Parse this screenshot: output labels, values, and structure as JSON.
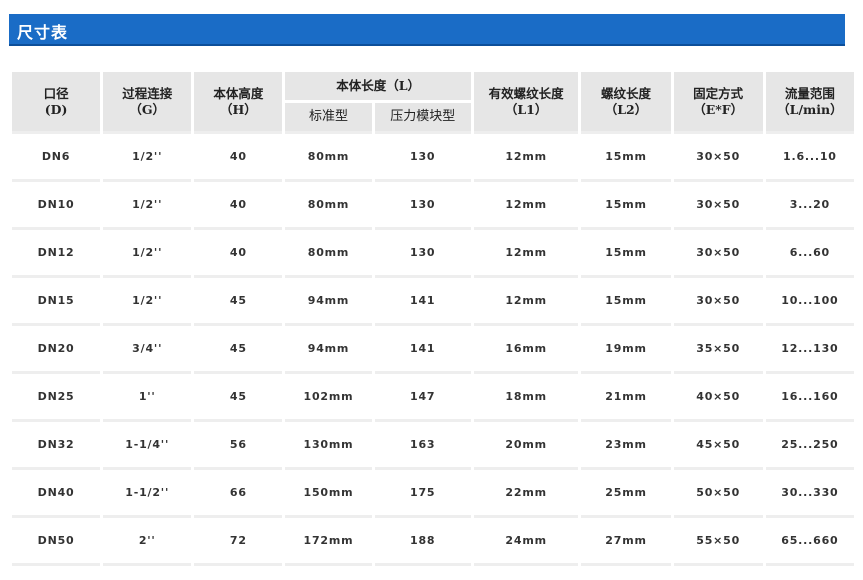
{
  "title": "尺寸表",
  "headers": {
    "diameter": [
      "口径",
      "(D)"
    ],
    "connection": [
      "过程连接",
      "（G）"
    ],
    "height": [
      "本体高度",
      "（H）"
    ],
    "length": "本体长度（L）",
    "length_standard": "标准型",
    "length_pressure": "压力模块型",
    "thread_effective": [
      "有效螺纹长度",
      "（L1）"
    ],
    "thread_length": [
      "螺纹长度",
      "（L2）"
    ],
    "fixing": [
      "固定方式",
      "（E*F）"
    ],
    "flow": [
      "流量范围",
      "（L/min）"
    ]
  },
  "rows": [
    [
      "DN6",
      "1/2''",
      "40",
      "80mm",
      "130",
      "12mm",
      "15mm",
      "30×50",
      "1.6...10"
    ],
    [
      "DN10",
      "1/2''",
      "40",
      "80mm",
      "130",
      "12mm",
      "15mm",
      "30×50",
      "3...20"
    ],
    [
      "DN12",
      "1/2''",
      "40",
      "80mm",
      "130",
      "12mm",
      "15mm",
      "30×50",
      "6...60"
    ],
    [
      "DN15",
      "1/2''",
      "45",
      "94mm",
      "141",
      "12mm",
      "15mm",
      "30×50",
      "10...100"
    ],
    [
      "DN20",
      "3/4''",
      "45",
      "94mm",
      "141",
      "16mm",
      "19mm",
      "35×50",
      "12...130"
    ],
    [
      "DN25",
      "1''",
      "45",
      "102mm",
      "147",
      "18mm",
      "21mm",
      "40×50",
      "16...160"
    ],
    [
      "DN32",
      "1-1/4''",
      "56",
      "130mm",
      "163",
      "20mm",
      "23mm",
      "45×50",
      "25...250"
    ],
    [
      "DN40",
      "1-1/2''",
      "66",
      "150mm",
      "175",
      "22mm",
      "25mm",
      "50×50",
      "30...330"
    ],
    [
      "DN50",
      "2''",
      "72",
      "172mm",
      "188",
      "24mm",
      "27mm",
      "55×50",
      "65...660"
    ]
  ]
}
